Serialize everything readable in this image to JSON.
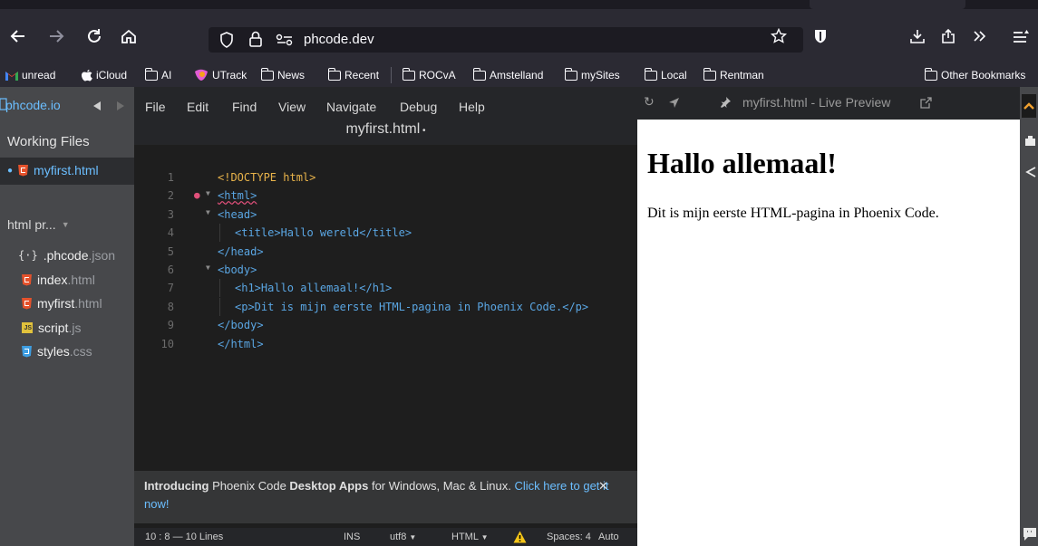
{
  "browser": {
    "url": "phcode.dev",
    "bookmarks": [
      {
        "label": "unread",
        "icon": "gmail-icon"
      },
      {
        "label": "iCloud",
        "icon": "apple-icon"
      },
      {
        "label": "AI",
        "icon": "folder-icon"
      },
      {
        "label": "UTrack",
        "icon": "utrack-icon"
      },
      {
        "label": "News",
        "icon": "folder-icon"
      },
      {
        "label": "Recent",
        "icon": "folder-icon"
      },
      {
        "label": "ROCvA",
        "icon": "folder-icon"
      },
      {
        "label": "Amstelland",
        "icon": "folder-icon"
      },
      {
        "label": "mySites",
        "icon": "folder-icon"
      },
      {
        "label": "Local",
        "icon": "folder-icon"
      },
      {
        "label": "Rentman",
        "icon": "folder-icon"
      }
    ],
    "other_bookmarks": "Other Bookmarks"
  },
  "sidebar": {
    "project_name": "phcode.io",
    "working_files_label": "Working Files",
    "working_files": [
      {
        "name": "myfirst",
        "ext": ".html",
        "icon": "html-file-icon"
      }
    ],
    "project_header": "html pr...",
    "files": [
      {
        "name": ".phcode",
        "ext": ".json",
        "icon": "json-file-icon"
      },
      {
        "name": "index",
        "ext": ".html",
        "icon": "html-file-icon"
      },
      {
        "name": "myfirst",
        "ext": ".html",
        "icon": "html-file-icon"
      },
      {
        "name": "script",
        "ext": ".js",
        "icon": "js-file-icon"
      },
      {
        "name": "styles",
        "ext": ".css",
        "icon": "css-file-icon"
      }
    ]
  },
  "editor": {
    "menu": [
      "File",
      "Edit",
      "Find",
      "View",
      "Navigate",
      "Debug",
      "Help"
    ],
    "doc_title": "myfirst.html",
    "lines": [
      {
        "num": "1",
        "text": "<!DOCTYPE html>"
      },
      {
        "num": "2",
        "text": "<html>"
      },
      {
        "num": "3",
        "text": "<head>"
      },
      {
        "num": "4",
        "text": "<title>Hallo wereld</title>"
      },
      {
        "num": "5",
        "text": "</head>"
      },
      {
        "num": "6",
        "text": "<body>"
      },
      {
        "num": "7",
        "text": "<h1>Hallo allemaal!</h1>"
      },
      {
        "num": "8",
        "text": "<p>Dit is mijn eerste HTML-pagina in Phoenix Code.</p>"
      },
      {
        "num": "9",
        "text": "</body>"
      },
      {
        "num": "10",
        "text": "</html>"
      }
    ],
    "notification": {
      "intro": "Introducing",
      "product": "Phoenix Code",
      "apps": "Desktop Apps",
      "platforms": "for Windows, Mac & Linux.",
      "link": "Click here to get it now!"
    },
    "status": {
      "cursor": "10 : 8 — 10 Lines",
      "mode": "INS",
      "encoding": "utf8",
      "language": "HTML",
      "indent": "Spaces: 4",
      "auto": "Auto"
    }
  },
  "preview": {
    "title": "myfirst.html - Live Preview",
    "h1": "Hallo allemaal!",
    "p": "Dit is mijn eerste HTML-pagina in Phoenix Code."
  },
  "colors": {
    "accent": "#6bbeff",
    "tag": "#5aa6e3",
    "doctype": "#e8b34a"
  }
}
